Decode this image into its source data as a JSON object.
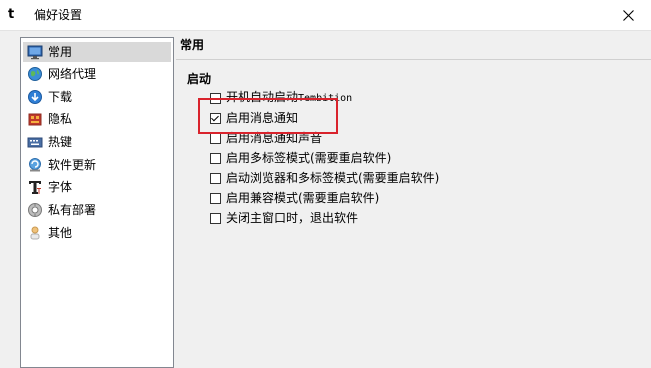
{
  "window": {
    "title": "偏好设置",
    "app_icon_glyph": "t",
    "close_glyph": "✕"
  },
  "sidebar": {
    "items": [
      {
        "label": "常用",
        "icon": "monitor-icon",
        "selected": true
      },
      {
        "label": "网络代理",
        "icon": "globe-icon",
        "selected": false
      },
      {
        "label": "下载",
        "icon": "download-icon",
        "selected": false
      },
      {
        "label": "隐私",
        "icon": "privacy-icon",
        "selected": false
      },
      {
        "label": "热键",
        "icon": "keyboard-icon",
        "selected": false
      },
      {
        "label": "软件更新",
        "icon": "update-icon",
        "selected": false
      },
      {
        "label": "字体",
        "icon": "font-icon",
        "selected": false
      },
      {
        "label": "私有部署",
        "icon": "private-deploy-icon",
        "selected": false
      },
      {
        "label": "其他",
        "icon": "other-icon",
        "selected": false
      }
    ]
  },
  "main": {
    "section_title": "常用",
    "group_title": "启动",
    "options": [
      {
        "label_prefix": "开机自动启动",
        "label_suffix": "Tembition",
        "checked": false
      },
      {
        "label": "启用消息通知",
        "checked": true
      },
      {
        "label": "启用消息通知声音",
        "checked": false
      },
      {
        "label": "启用多标签模式(需要重启软件)",
        "checked": false
      },
      {
        "label": "启动浏览器和多标签模式(需要重启软件)",
        "checked": false
      },
      {
        "label": "启用兼容模式(需要重启软件)",
        "checked": false
      },
      {
        "label": "关闭主窗口时，退出软件",
        "checked": false
      }
    ]
  },
  "colors": {
    "highlight_border": "#d9232c",
    "selected_item_bg": "#d9d9d9"
  }
}
